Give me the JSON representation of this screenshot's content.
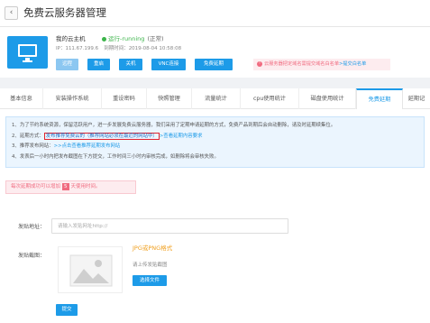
{
  "header": {
    "back_icon": "chevron-left-icon",
    "title": "免费云服务器管理"
  },
  "server": {
    "name": "我的云主机",
    "status": "运行-running",
    "status_note": "(正常)",
    "ip_line": "IP：111.67.199.6",
    "expire_line": "到期时间：2019-08-04 10:58:08",
    "status_color": "#3bb44a"
  },
  "actions": {
    "login": "远程",
    "restart": "重启",
    "shutdown": "关机",
    "vnc": "VNC连接",
    "renew": "免费延期"
  },
  "alert": {
    "text": "云服务器把定域名需提交域名白名单",
    "link": ">提交白名单"
  },
  "tabs": [
    "基本信息",
    "安装操作系统",
    "重设密码",
    "快照管理",
    "流量统计",
    "cpu使用统计",
    "磁盘使用统计",
    "免费延期",
    "延期记"
  ],
  "notice": {
    "line1": "1、为了节约系统资源，保留活跃用户，进一步发展免费云服务器，我们采用了定期申请延期的方式，免费产品到期后会自动删除，请及时延期续集位。",
    "line2_prefix": "2、延期方式：",
    "line2_highlight": "发布推荐免费云的（推荐网站必须在最近的网站中）",
    "line2_link": ">查看延期内容要求",
    "line3_prefix": "3、推荐发布网站：",
    "line3_link": ">>点击查看推荐延期发布网站",
    "line4": "4、发表后一小时内把发布截图在下方提交，工作时间三小时内审核完成，如删除将会审核失败。"
  },
  "warning": {
    "prefix": "每次延期成功可以增加",
    "count": "5",
    "suffix": "天使用时间。"
  },
  "form": {
    "url_label": "发贴地址：",
    "url_placeholder": "请输入发贴网址http://",
    "image_label": "发贴截图：",
    "format_hint": "JPG或PNG格式",
    "upload_hint": "请上传发贴截图",
    "choose_file": "选择文件",
    "submit": "提交"
  },
  "colors": {
    "accent": "#1d9be8",
    "warning": "#f06a7f",
    "highlight_border": "#e0242f"
  }
}
